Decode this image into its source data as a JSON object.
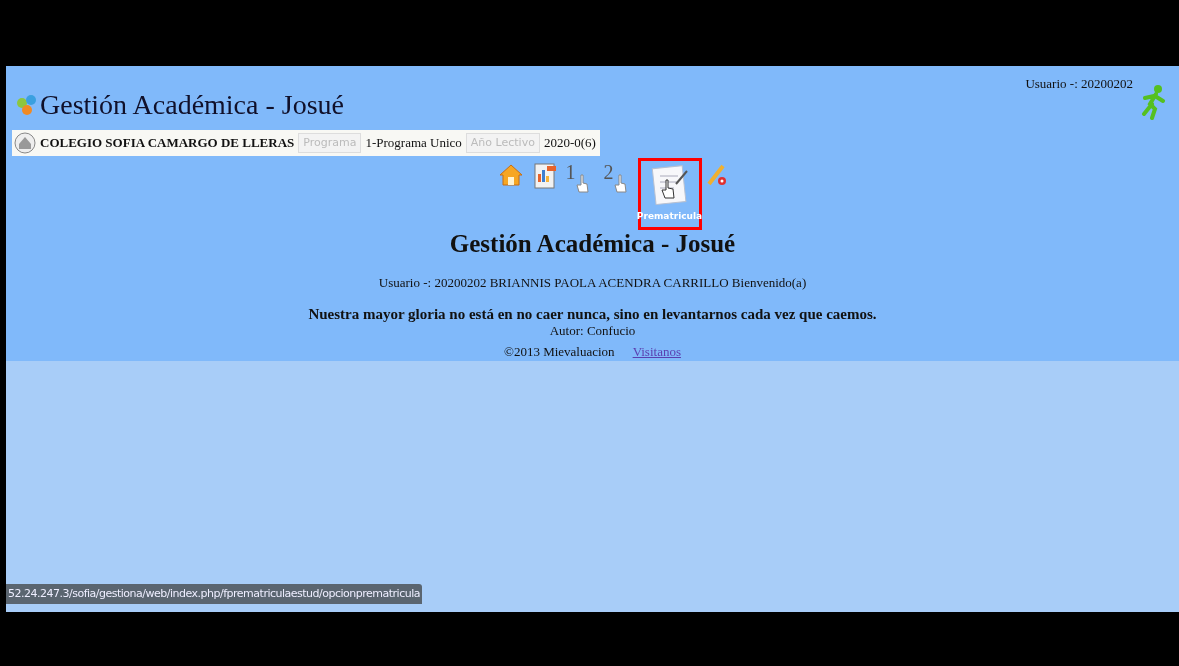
{
  "header": {
    "title": "Gestión Académica - Josué",
    "user": "Usuario -: 20200202"
  },
  "school_bar": {
    "school": "COLEGIO SOFIA CAMARGO DE LLERAS",
    "program_label": "Programa",
    "program": "1-Programa Unico",
    "year_label": "Año Lectivo",
    "year": "2020-0(6)"
  },
  "toolbar": [
    {
      "kind": "home",
      "selected": false
    },
    {
      "kind": "report",
      "selected": false
    },
    {
      "kind": "hand",
      "label": "1",
      "selected": false
    },
    {
      "kind": "hand",
      "label": "2",
      "selected": false
    },
    {
      "kind": "form",
      "label": "Prematricula",
      "selected": true
    },
    {
      "kind": "pencil",
      "selected": false
    }
  ],
  "main": {
    "heading": "Gestión Académica - Josué",
    "user_line": "Usuario -: 20200202 BRIANNIS PAOLA ACENDRA CARRILLO Bienvenido(a)",
    "quote": "Nuestra mayor gloria no está en no caer nunca, sino en levantarnos cada vez que caemos.",
    "author": "Autor: Confucio",
    "copyright": "©2013 Mievaluacion",
    "link": "Visitanos"
  },
  "status_url": "52.24.247.3/sofia/gestiona/web/index.php/fprematriculaestud/opcionprematricula"
}
